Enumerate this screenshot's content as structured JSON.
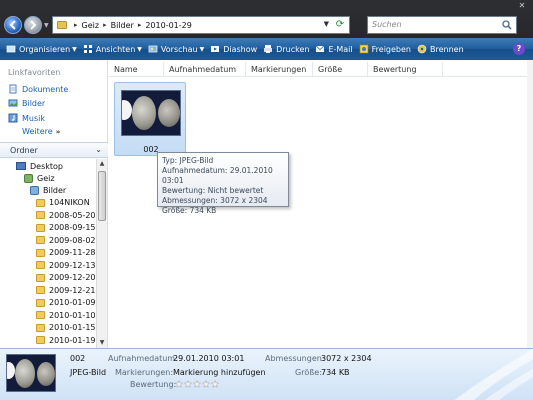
{
  "address": {
    "segments": [
      "Geiz",
      "Bilder",
      "2010-01-29"
    ],
    "search_placeholder": "Suchen"
  },
  "toolbar": {
    "organize": "Organisieren",
    "views": "Ansichten",
    "preview": "Vorschau",
    "slideshow": "Diashow",
    "print": "Drucken",
    "email": "E-Mail",
    "share": "Freigeben",
    "burn": "Brennen",
    "help": "?"
  },
  "sidebar": {
    "favorites_title": "Linkfavoriten",
    "favorites": [
      "Dokumente",
      "Bilder",
      "Musik"
    ],
    "more": "Weitere",
    "folders_title": "Ordner",
    "tree": [
      "Desktop",
      "Geiz",
      "Bilder",
      "104NIKON",
      "2008-05-20",
      "2008-09-15",
      "2009-08-02",
      "2009-11-28",
      "2009-12-13",
      "2009-12-20",
      "2009-12-21",
      "2010-01-09",
      "2010-01-10",
      "2010-01-15",
      "2010-01-19"
    ]
  },
  "columns": [
    "Name",
    "Aufnahmedatum",
    "Markierungen",
    "Größe",
    "Bewertung"
  ],
  "file": {
    "name": "002"
  },
  "tooltip": {
    "type": "Typ: JPEG-Bild",
    "date": "Aufnahmedatum: 29.01.2010 03:01",
    "rating": "Bewertung: Nicht bewertet",
    "dims": "Abmessungen: 3072 x 2304",
    "size": "Größe: 734 KB"
  },
  "details": {
    "name": "002",
    "type": "JPEG-Bild",
    "date_label": "Aufnahmedatum:",
    "date_value": "29.01.2010 03:01",
    "tags_label": "Markierungen:",
    "tags_value": "Markierung hinzufügen",
    "rating_label": "Bewertung:",
    "dims_label": "Abmessungen:",
    "dims_value": "3072 x 2304",
    "size_label": "Größe:",
    "size_value": "734 KB",
    "rating_stars": 0
  }
}
